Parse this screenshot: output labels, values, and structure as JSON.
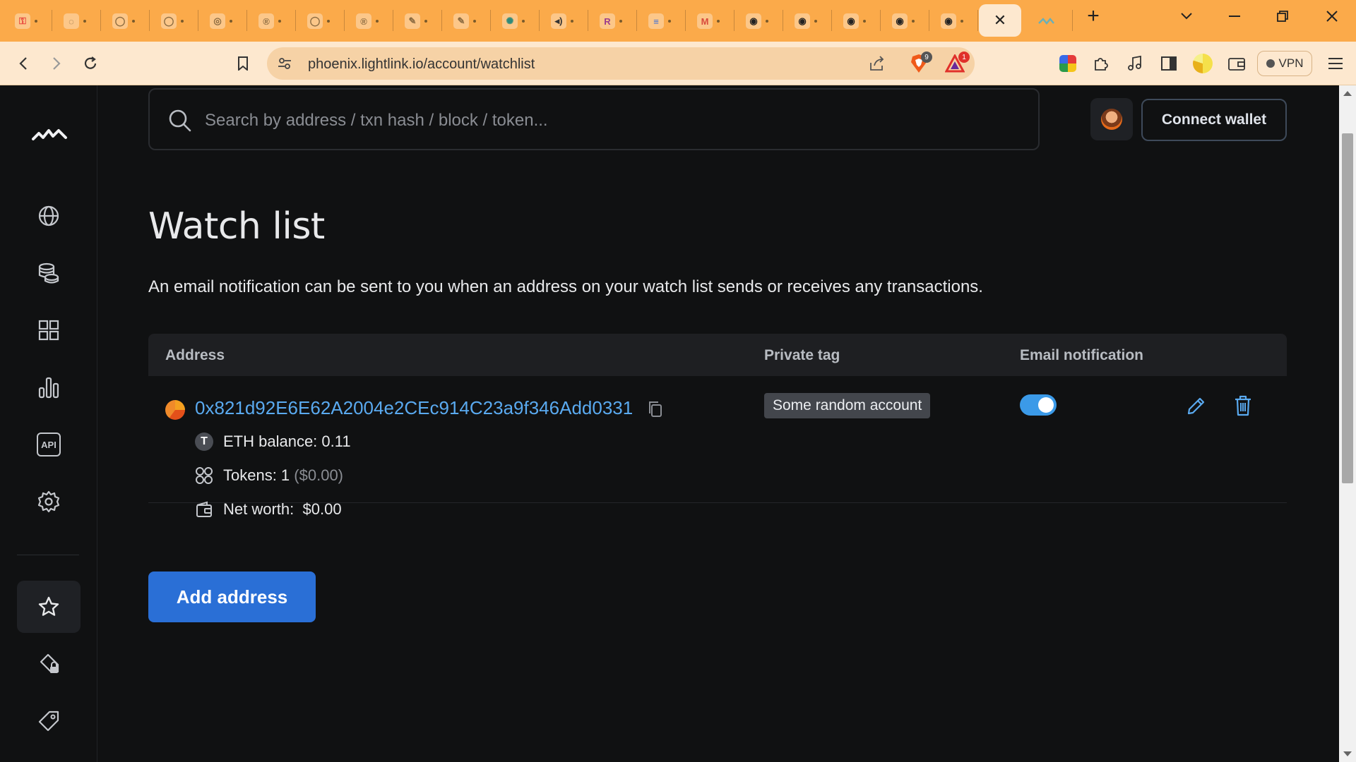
{
  "browser": {
    "tabs": [
      {
        "icon": "red-key-icon",
        "color": "#e8453c",
        "glyph": "⚿"
      },
      {
        "icon": "loading-icon",
        "color": "#8a6a40",
        "glyph": "◌"
      },
      {
        "icon": "globe-icon",
        "color": "#8a6a40",
        "glyph": "◯"
      },
      {
        "icon": "globe-icon",
        "color": "#8a6a40",
        "glyph": "◯"
      },
      {
        "icon": "compass-icon",
        "color": "#8a6a40",
        "glyph": "◎"
      },
      {
        "icon": "r-logo-icon",
        "color": "#8a6a40",
        "glyph": "®"
      },
      {
        "icon": "globe-icon",
        "color": "#8a6a40",
        "glyph": "◯"
      },
      {
        "icon": "r-logo-icon",
        "color": "#8a6a40",
        "glyph": "®"
      },
      {
        "icon": "note-icon",
        "color": "#8a6a40",
        "glyph": "✎"
      },
      {
        "icon": "note-icon",
        "color": "#8a6a40",
        "glyph": "✎"
      },
      {
        "icon": "openai-icon",
        "color": "#2f8a7a",
        "glyph": "✺"
      },
      {
        "icon": "speaker-icon",
        "color": "#333333",
        "glyph": "◂)"
      },
      {
        "icon": "r-app-icon",
        "color": "#9b3c8c",
        "glyph": "R"
      },
      {
        "icon": "docs-icon",
        "color": "#3b6fd8",
        "glyph": "≡"
      },
      {
        "icon": "gmail-icon",
        "color": "#d84a3c",
        "glyph": "M"
      },
      {
        "icon": "github-icon",
        "color": "#222222",
        "glyph": "◉"
      },
      {
        "icon": "github-icon",
        "color": "#222222",
        "glyph": "◉"
      },
      {
        "icon": "github-icon",
        "color": "#222222",
        "glyph": "◉"
      },
      {
        "icon": "github-icon",
        "color": "#222222",
        "glyph": "◉"
      },
      {
        "icon": "github-icon",
        "color": "#222222",
        "glyph": "◉"
      }
    ],
    "active_tab_close": "✕",
    "url": "phoenix.lightlink.io/account/watchlist",
    "brave_badge": "9",
    "alert_badge": "1",
    "vpn_label": "VPN"
  },
  "sidebar": {
    "items": [
      {
        "name": "blockchain",
        "icon": "globe-icon"
      },
      {
        "name": "tokens",
        "icon": "coins-icon"
      },
      {
        "name": "apps",
        "icon": "grid-icon"
      },
      {
        "name": "stats",
        "icon": "bar-chart-icon"
      },
      {
        "name": "api",
        "icon": "api-icon",
        "label": "API"
      },
      {
        "name": "settings",
        "icon": "gear-icon"
      },
      {
        "name": "watchlist",
        "icon": "star-icon"
      },
      {
        "name": "private-tags",
        "icon": "tag-lock-icon"
      },
      {
        "name": "public-tags",
        "icon": "tag-icon"
      }
    ]
  },
  "header": {
    "search_placeholder": "Search by address / txn hash / block / token...",
    "connect_label": "Connect wallet"
  },
  "page": {
    "title": "Watch list",
    "description": "An email notification can be sent to you when an address on your watch list sends or receives any transactions."
  },
  "table": {
    "columns": [
      "Address",
      "Private tag",
      "Email notification"
    ],
    "rows": [
      {
        "address": "0x821d92E6E62A2004e2CEc914C23a9f346Add0331",
        "balance_label": "ETH balance: 0.11",
        "balance_badge": "T",
        "tokens_label": "Tokens: 1",
        "tokens_value": "($0.00)",
        "networth_label": "Net worth:",
        "networth_value": "$0.00",
        "private_tag": "Some random account",
        "email_notification": true
      }
    ]
  },
  "actions": {
    "add_label": "Add address"
  },
  "colors": {
    "background": "#101112",
    "accent": "#2a6fd6",
    "link": "#5aaaf0",
    "browser_orange": "#fbaa4a"
  }
}
